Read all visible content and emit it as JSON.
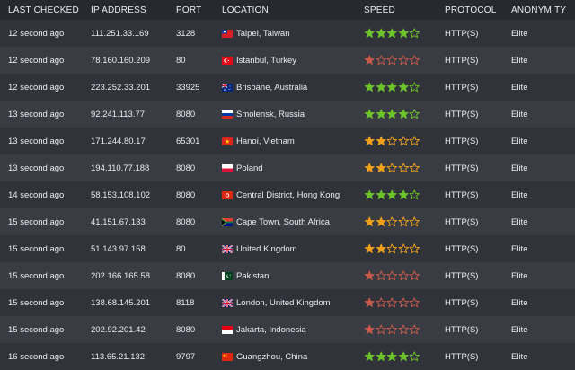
{
  "columns": {
    "last_checked": "LAST CHECKED",
    "ip": "IP ADDRESS",
    "port": "PORT",
    "location": "LOCATION",
    "speed": "SPEED",
    "protocol": "PROTOCOL",
    "anonymity": "ANONYMITY"
  },
  "colors": {
    "good": "#6ec42b",
    "medium": "#f0a11b",
    "poor": "#c85a4c"
  },
  "rows": [
    {
      "last_checked": "12 second ago",
      "ip": "111.251.33.169",
      "port": "3128",
      "flag": "taiwan-flag-icon",
      "location": "Taipei, Taiwan",
      "speed": 4,
      "protocol": "HTTP(S)",
      "anonymity": "Elite"
    },
    {
      "last_checked": "12 second ago",
      "ip": "78.160.160.209",
      "port": "80",
      "flag": "turkey-flag-icon",
      "location": "Istanbul, Turkey",
      "speed": 1,
      "protocol": "HTTP(S)",
      "anonymity": "Elite"
    },
    {
      "last_checked": "12 second ago",
      "ip": "223.252.33.201",
      "port": "33925",
      "flag": "australia-flag-icon",
      "location": "Brisbane, Australia",
      "speed": 4,
      "protocol": "HTTP(S)",
      "anonymity": "Elite"
    },
    {
      "last_checked": "13 second ago",
      "ip": "92.241.113.77",
      "port": "8080",
      "flag": "russia-flag-icon",
      "location": "Smolensk, Russia",
      "speed": 4,
      "protocol": "HTTP(S)",
      "anonymity": "Elite"
    },
    {
      "last_checked": "13 second ago",
      "ip": "171.244.80.17",
      "port": "65301",
      "flag": "vietnam-flag-icon",
      "location": "Hanoi, Vietnam",
      "speed": 2,
      "protocol": "HTTP(S)",
      "anonymity": "Elite"
    },
    {
      "last_checked": "13 second ago",
      "ip": "194.110.77.188",
      "port": "8080",
      "flag": "poland-flag-icon",
      "location": "Poland",
      "speed": 2,
      "protocol": "HTTP(S)",
      "anonymity": "Elite"
    },
    {
      "last_checked": "14 second ago",
      "ip": "58.153.108.102",
      "port": "8080",
      "flag": "hong-kong-flag-icon",
      "location": "Central District, Hong Kong",
      "speed": 4,
      "protocol": "HTTP(S)",
      "anonymity": "Elite"
    },
    {
      "last_checked": "15 second ago",
      "ip": "41.151.67.133",
      "port": "8080",
      "flag": "south-africa-flag-icon",
      "location": "Cape Town, South Africa",
      "speed": 2,
      "protocol": "HTTP(S)",
      "anonymity": "Elite"
    },
    {
      "last_checked": "15 second ago",
      "ip": "51.143.97.158",
      "port": "80",
      "flag": "uk-flag-icon",
      "location": "United Kingdom",
      "speed": 2,
      "protocol": "HTTP(S)",
      "anonymity": "Elite"
    },
    {
      "last_checked": "15 second ago",
      "ip": "202.166.165.58",
      "port": "8080",
      "flag": "pakistan-flag-icon",
      "location": "Pakistan",
      "speed": 1,
      "protocol": "HTTP(S)",
      "anonymity": "Elite"
    },
    {
      "last_checked": "15 second ago",
      "ip": "138.68.145.201",
      "port": "8118",
      "flag": "uk-flag-icon",
      "location": "London, United Kingdom",
      "speed": 1,
      "protocol": "HTTP(S)",
      "anonymity": "Elite"
    },
    {
      "last_checked": "15 second ago",
      "ip": "202.92.201.42",
      "port": "8080",
      "flag": "indonesia-flag-icon",
      "location": "Jakarta, Indonesia",
      "speed": 1,
      "protocol": "HTTP(S)",
      "anonymity": "Elite"
    },
    {
      "last_checked": "16 second ago",
      "ip": "113.65.21.132",
      "port": "9797",
      "flag": "china-flag-icon",
      "location": "Guangzhou, China",
      "speed": 4,
      "protocol": "HTTP(S)",
      "anonymity": "Elite"
    }
  ]
}
